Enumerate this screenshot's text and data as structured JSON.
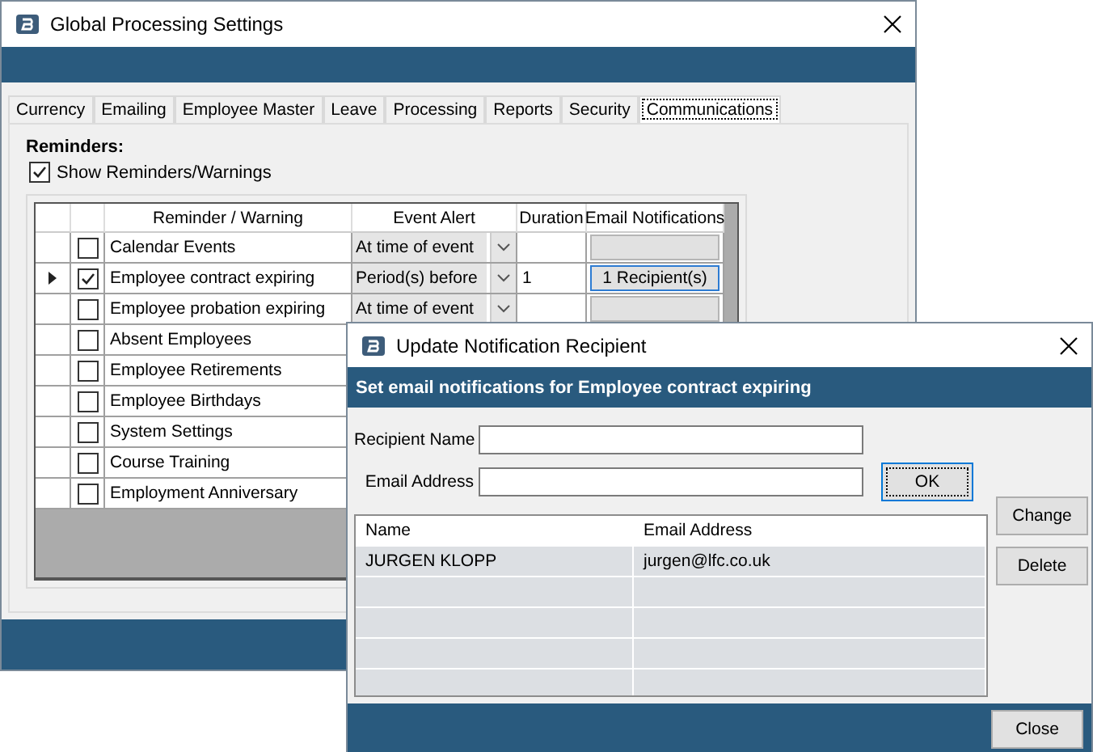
{
  "main_window": {
    "title": "Global Processing Settings",
    "tabs": [
      {
        "label": "Currency",
        "selected": false
      },
      {
        "label": "Emailing",
        "selected": false
      },
      {
        "label": "Employee Master",
        "selected": false
      },
      {
        "label": "Leave",
        "selected": false
      },
      {
        "label": "Processing",
        "selected": false
      },
      {
        "label": "Reports",
        "selected": false
      },
      {
        "label": "Security",
        "selected": false
      },
      {
        "label": "Communications",
        "selected": true
      }
    ],
    "section_label": "Reminders:",
    "show_reminders": {
      "label": "Show Reminders/Warnings",
      "checked": true
    },
    "grid": {
      "columns": [
        "Reminder / Warning",
        "Event Alert",
        "Duration",
        "Email Notifications"
      ],
      "rows": [
        {
          "name": "Calendar Events",
          "checked": false,
          "current": false,
          "event_alert": "At time of event",
          "email": {
            "enabled": false
          }
        },
        {
          "name": "Employee contract expiring",
          "checked": true,
          "current": true,
          "event_alert": "Period(s) before",
          "duration": "1",
          "email": {
            "label": "1 Recipient(s)",
            "enabled": true
          }
        },
        {
          "name": "Employee probation expiring",
          "checked": false,
          "current": false,
          "event_alert": "At time of event",
          "email": {
            "enabled": false
          }
        },
        {
          "name": "Absent Employees",
          "checked": false,
          "current": false
        },
        {
          "name": "Employee Retirements",
          "checked": false,
          "current": false
        },
        {
          "name": "Employee Birthdays",
          "checked": false,
          "current": false
        },
        {
          "name": "System Settings",
          "checked": false,
          "current": false
        },
        {
          "name": "Course Training",
          "checked": false,
          "current": false
        },
        {
          "name": "Employment Anniversary",
          "checked": false,
          "current": false
        }
      ]
    }
  },
  "dialog": {
    "title": "Update Notification Recipient",
    "heading": "Set email notifications for Employee contract expiring",
    "fields": [
      {
        "label": "Recipient Name"
      },
      {
        "label": "Email Address"
      }
    ],
    "ok_button": "OK",
    "list": {
      "columns": [
        "Name",
        "Email Address"
      ],
      "rows": [
        {
          "name": "JURGEN KLOPP",
          "email": "jurgen@lfc.co.uk"
        }
      ]
    },
    "buttons": [
      "Change",
      "Delete"
    ],
    "close_button": "Close"
  }
}
